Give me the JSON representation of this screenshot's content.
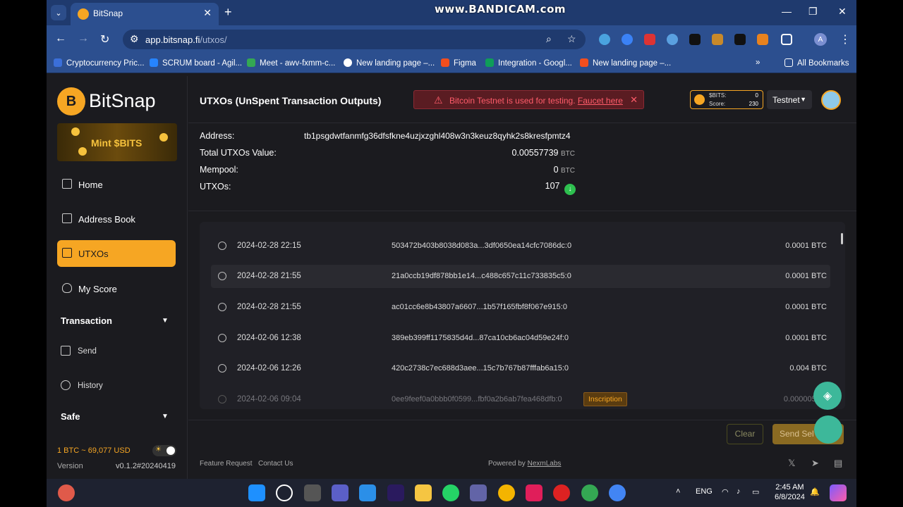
{
  "watermark": "www.BANDICAM.com",
  "browser": {
    "tab_title": "BitSnap",
    "url_host": "app.bitsnap.fi",
    "url_path": "/utxos/",
    "profile_initial": "A",
    "bookmarks": [
      {
        "label": "Cryptocurrency Pric...",
        "color": "#3b6fd9"
      },
      {
        "label": "SCRUM board - Agil...",
        "color": "#2684ff"
      },
      {
        "label": "Meet - awv-fxmm-c...",
        "color": "#34a853"
      },
      {
        "label": "New landing page –...",
        "color": "#ffffff"
      },
      {
        "label": "Figma",
        "color": "#f24e1e"
      },
      {
        "label": "Integration - Googl...",
        "color": "#0f9d58"
      },
      {
        "label": "New landing page –...",
        "color": "#f24e1e"
      }
    ],
    "all_bookmarks": "All Bookmarks"
  },
  "sidebar": {
    "brand": "BitSnap",
    "banner": "Mint $BITS",
    "nav": [
      {
        "label": "Home"
      },
      {
        "label": "Address Book"
      },
      {
        "label": "UTXOs"
      },
      {
        "label": "My Score"
      }
    ],
    "transaction_section": "Transaction",
    "transaction_items": [
      "Send",
      "History"
    ],
    "safe_section": "Safe",
    "price": "1 BTC ~ 69,077 USD",
    "version_label": "Version",
    "version_value": "v0.1.2#20240419"
  },
  "header": {
    "title": "UTXOs (UnSpent Transaction Outputs)",
    "alert_text": "Bitcoin Testnet is used for testing.",
    "alert_link": "Faucet here",
    "bits_label": "$BITS:",
    "bits_value": "0",
    "score_label": "Score:",
    "score_value": "230",
    "network": "Testnet"
  },
  "summary": {
    "address_label": "Address:",
    "address_value": "tb1psgdwtfanmfg36dfsfkne4uzjxzghl408w3n3keuz8qyhk2s8kresfpmtz4",
    "total_label": "Total UTXOs Value:",
    "total_value": "0.00557739",
    "total_unit": "BTC",
    "mempool_label": "Mempool:",
    "mempool_value": "0",
    "mempool_unit": "BTC",
    "utxos_label": "UTXOs:",
    "utxos_value": "107"
  },
  "utxos": [
    {
      "date": "2024-02-28 22:15",
      "hash": "503472b403b8038d083a...3df0650ea14cfc7086dc:0",
      "amount": "0.0001 BTC",
      "tag": ""
    },
    {
      "date": "2024-02-28 21:55",
      "hash": "21a0ccb19df878bb1e14...c488c657c11c733835c5:0",
      "amount": "0.0001 BTC",
      "tag": ""
    },
    {
      "date": "2024-02-28 21:55",
      "hash": "ac01cc6e8b43807a6607...1b57f165fbf8f067e915:0",
      "amount": "0.0001 BTC",
      "tag": ""
    },
    {
      "date": "2024-02-06 12:38",
      "hash": "389eb399ff1175835d4d...87ca10cb6ac04d59e24f:0",
      "amount": "0.0001 BTC",
      "tag": ""
    },
    {
      "date": "2024-02-06 12:26",
      "hash": "420c2738c7ec688d3aee...15c7b767b87fffab6a15:0",
      "amount": "0.004 BTC",
      "tag": ""
    },
    {
      "date": "2024-02-06 09:04",
      "hash": "0ee9feef0a0bbb0f0599...fbf0a2b6ab7fea468dfb:0",
      "amount": "0.00000546",
      "tag": "Inscription"
    }
  ],
  "actions": {
    "clear": "Clear",
    "send": "Send Sel"
  },
  "footer": {
    "feature_request": "Feature Request",
    "contact_us": "Contact Us",
    "powered_by": "Powered by",
    "powered_link": "NexmLabs"
  },
  "taskbar": {
    "lang": "ENG",
    "time": "2:45 AM",
    "date": "6/8/2024"
  }
}
